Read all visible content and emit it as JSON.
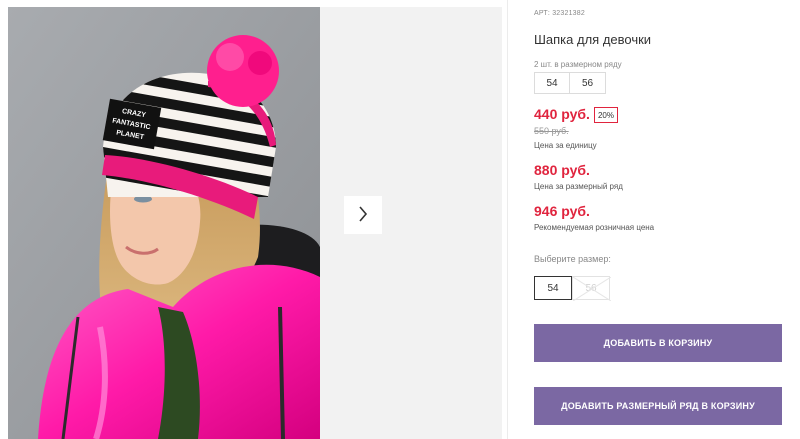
{
  "product": {
    "article_label": "АРТ:",
    "article_number": "32321382",
    "title": "Шапка для девочки",
    "hat_text": [
      "CRAZY",
      "FANTASTIC",
      "PLANET"
    ]
  },
  "size_range": {
    "label": "2 шт. в размерном ряду",
    "sizes": [
      "54",
      "56"
    ]
  },
  "pricing": {
    "unit_price": "440 руб.",
    "discount": "20%",
    "old_price": "550 руб.",
    "unit_caption": "Цена за единицу",
    "range_price": "880 руб.",
    "range_caption": "Цена за размерный ряд",
    "retail_price": "946 руб.",
    "retail_caption": "Рекомендуемая розничная цена"
  },
  "size_select": {
    "label": "Выберите размер:",
    "options": [
      {
        "value": "54",
        "state": "selected"
      },
      {
        "value": "56",
        "state": "unavailable"
      }
    ]
  },
  "buttons": {
    "add_to_cart": "ДОБАВИТЬ В КОРЗИНУ",
    "add_range_to_cart": "ДОБАВИТЬ РАЗМЕРНЫЙ РЯД В КОРЗИНУ"
  },
  "icons": {
    "next": "chevron-right-icon",
    "unavailable": "cross-icon"
  },
  "colors": {
    "price": "#e0243e",
    "button": "#7b68a3"
  }
}
